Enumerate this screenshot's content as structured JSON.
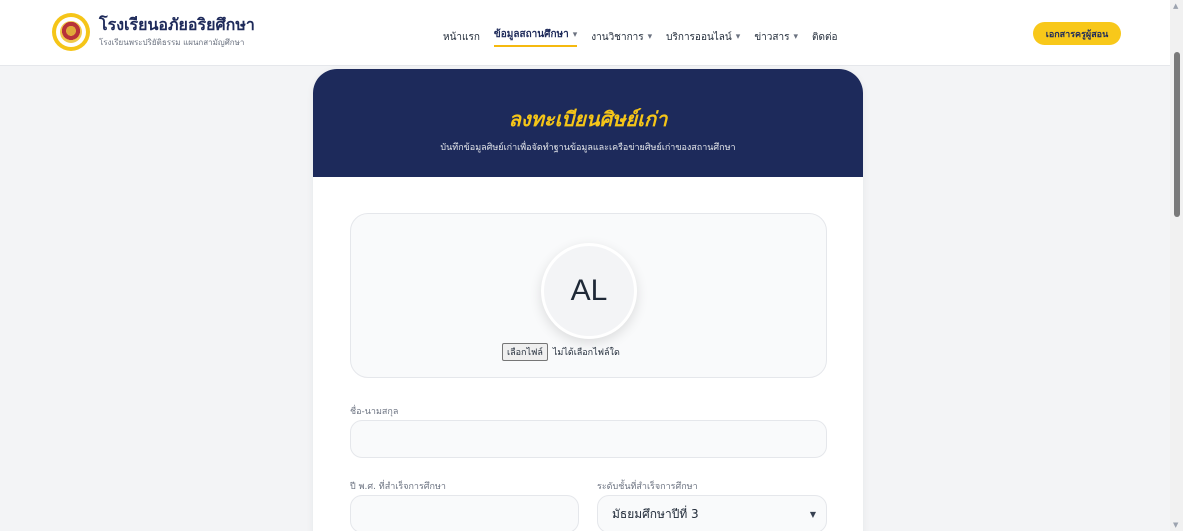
{
  "brand": {
    "title": "โรงเรียนอภัยอริยศึกษา",
    "subtitle": "โรงเรียนพระปริยัติธรรม แผนกสามัญศึกษา"
  },
  "nav": {
    "items": [
      {
        "label": "หน้าแรก",
        "has_dropdown": false,
        "active": false
      },
      {
        "label": "ข้อมูลสถานศึกษา",
        "has_dropdown": true,
        "active": true
      },
      {
        "label": "งานวิชาการ",
        "has_dropdown": true,
        "active": false
      },
      {
        "label": "บริการออนไลน์",
        "has_dropdown": true,
        "active": false
      },
      {
        "label": "ข่าวสาร",
        "has_dropdown": true,
        "active": false
      },
      {
        "label": "ติดต่อ",
        "has_dropdown": false,
        "active": false
      }
    ],
    "cta": "เอกสารครูผู้สอน"
  },
  "form": {
    "title": "ลงทะเบียนศิษย์เก่า",
    "subtitle": "บันทึกข้อมูลศิษย์เก่าเพื่อจัดทำฐานข้อมูลและเครือข่ายศิษย์เก่าของสถานศึกษา",
    "avatar_initials": "AL",
    "file_button": "เลือกไฟล์",
    "file_status": "ไม่ได้เลือกไฟล์ใด",
    "name_label": "ชื่อ-นามสกุล",
    "name_value": "",
    "year_label": "ปี พ.ศ. ที่สำเร็จการศึกษา",
    "year_value": "",
    "level_label": "ระดับชั้นที่สำเร็จการศึกษา",
    "level_value": "มัธยมศึกษาปีที่ 3"
  },
  "colors": {
    "navy": "#1d2a5b",
    "accent": "#f5c518"
  }
}
